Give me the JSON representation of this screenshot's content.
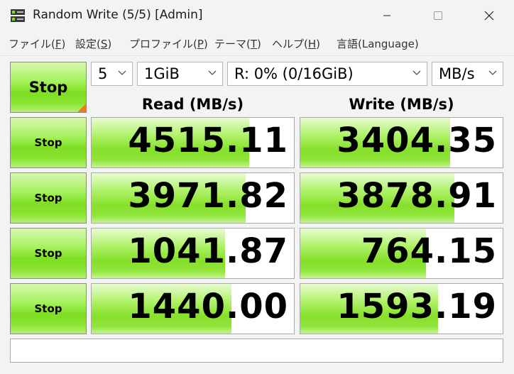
{
  "window": {
    "title": "Random Write (5/5) [Admin]"
  },
  "menu": [
    {
      "label": "ファイル(",
      "key": "F",
      "suffix": ")"
    },
    {
      "label": "設定(",
      "key": "S",
      "suffix": ")"
    },
    {
      "label": "プロファイル(",
      "key": "P",
      "suffix": ")"
    },
    {
      "label": "テーマ(",
      "key": "T",
      "suffix": ")"
    },
    {
      "label": "ヘルプ(",
      "key": "H",
      "suffix": ")"
    },
    {
      "label": "言語(",
      "key": "Language",
      "suffix": ")"
    }
  ],
  "controls": {
    "main_button": "Stop",
    "count": "5",
    "size": "1GiB",
    "drive": "R: 0% (0/16GiB)",
    "unit": "MB/s"
  },
  "headers": {
    "read": "Read (MB/s)",
    "write": "Write (MB/s)"
  },
  "rows": [
    {
      "button": "Stop",
      "read": "4515.11",
      "write": "3404.35",
      "read_fill": 0.78,
      "write_fill": 0.74
    },
    {
      "button": "Stop",
      "read": "3971.82",
      "write": "3878.91",
      "read_fill": 0.76,
      "write_fill": 0.76
    },
    {
      "button": "Stop",
      "read": "1041.87",
      "write": "764.15",
      "read_fill": 0.66,
      "write_fill": 0.62
    },
    {
      "button": "Stop",
      "read": "1440.00",
      "write": "1593.19",
      "read_fill": 0.69,
      "write_fill": 0.68
    }
  ],
  "comment": "",
  "colors": {
    "accent_green": "#86e02a",
    "corner_orange": "#f07c1c"
  }
}
